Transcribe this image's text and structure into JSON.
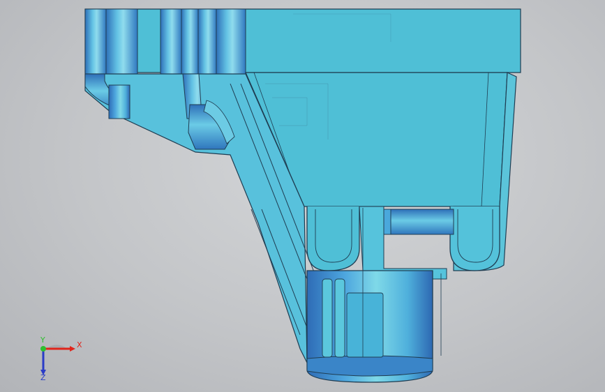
{
  "viewport": {
    "colors": {
      "part_base": "#4fbfd6",
      "part_light": "#7fd7ea",
      "part_dark": "#2e6fb8",
      "edge": "#1f3d52",
      "background": "#c3c5c8"
    }
  },
  "triad": {
    "x_label": "X",
    "y_label": "Y",
    "z_label": "Z",
    "colors": {
      "x": "#e0251b",
      "y": "#2fbf2f",
      "z": "#2a3cc7"
    }
  }
}
